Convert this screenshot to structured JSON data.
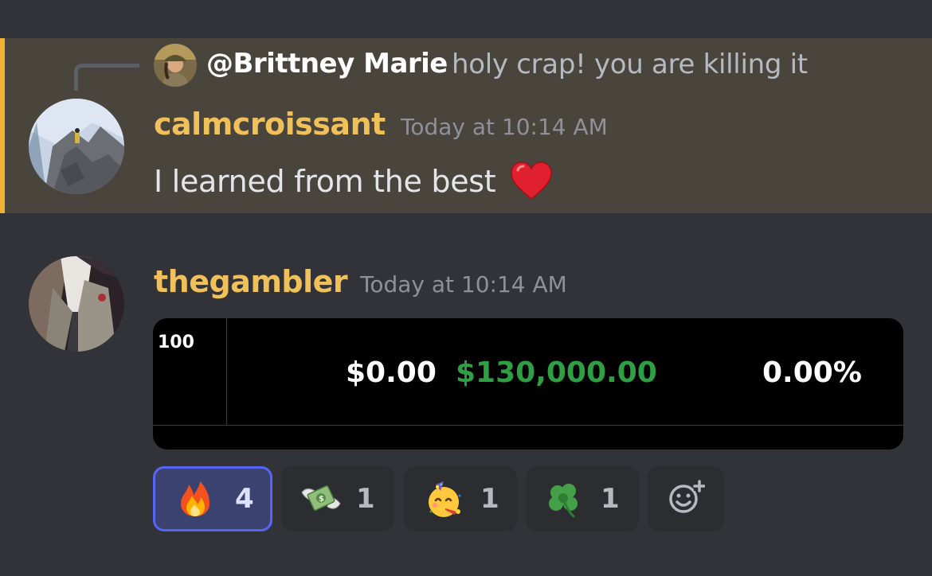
{
  "messages": [
    {
      "reply": {
        "author": "@Brittney Marie",
        "text": "holy crap! you are killing it"
      },
      "author": "calmcroissant",
      "timestamp": "Today at 10:14 AM",
      "content": "I learned from the best",
      "content_emoji": "red-heart-emoji",
      "highlighted": true
    },
    {
      "author": "thegambler",
      "timestamp": "Today at 10:14 AM",
      "embed": {
        "quantity": "100",
        "price": "$0.00",
        "value": "$130,000.00",
        "percent": "0.00%"
      },
      "reactions": [
        {
          "emoji": "fire-emoji",
          "count": "4",
          "active": true
        },
        {
          "emoji": "money-with-wings-emoji",
          "count": "1",
          "active": false
        },
        {
          "emoji": "partying-face-emoji",
          "count": "1",
          "active": false
        },
        {
          "emoji": "shamrock-emoji",
          "count": "1",
          "active": false
        }
      ],
      "add_reaction_icon": "add-reaction-icon"
    }
  ],
  "colors": {
    "background": "#313338",
    "highlight": "#49443c",
    "highlight_bar": "#f0b232",
    "username": "#f0c15a",
    "gain_green": "#2ea043",
    "active_reaction_border": "#5865f2"
  }
}
